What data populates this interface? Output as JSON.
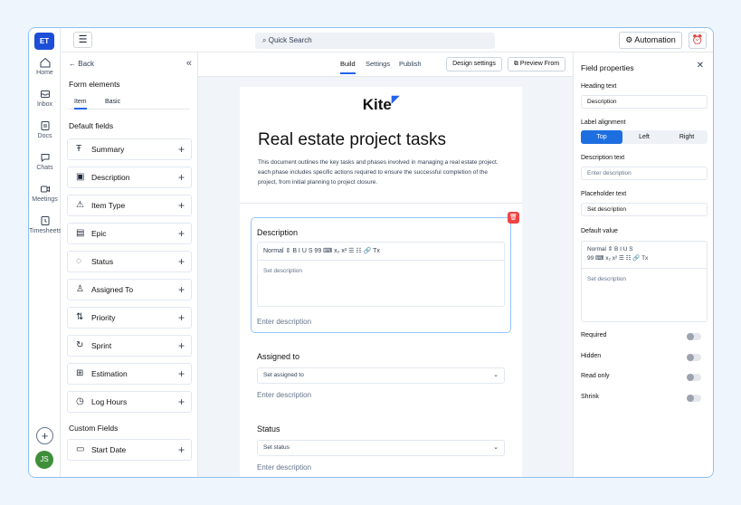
{
  "rail": {
    "workspace_initials": "ET",
    "items": [
      {
        "label": "Home",
        "icon": "home-icon"
      },
      {
        "label": "Inbox",
        "icon": "inbox-icon"
      },
      {
        "label": "Docs",
        "icon": "docs-icon"
      },
      {
        "label": "Chats",
        "icon": "chats-icon"
      },
      {
        "label": "Meetings",
        "icon": "meetings-icon"
      },
      {
        "label": "Timesheets",
        "icon": "timesheets-icon"
      }
    ],
    "add_label": "+",
    "avatar_initials": "JS"
  },
  "topbar": {
    "search_placeholder": "Quick Search",
    "automation_label": "Automation"
  },
  "left_panel": {
    "back_label": "Back",
    "collapse_label": "«",
    "title": "Form elements",
    "tabs": [
      "Item",
      "Basic"
    ],
    "default_fields_heading": "Default fields",
    "default_fields": [
      {
        "label": "Summary",
        "icon": "text-icon"
      },
      {
        "label": "Description",
        "icon": "description-icon"
      },
      {
        "label": "Item Type",
        "icon": "warning-icon"
      },
      {
        "label": "Epic",
        "icon": "epic-icon"
      },
      {
        "label": "Status",
        "icon": "status-icon"
      },
      {
        "label": "Assigned To",
        "icon": "user-icon"
      },
      {
        "label": "Priority",
        "icon": "priority-icon"
      },
      {
        "label": "Sprint",
        "icon": "sprint-icon"
      },
      {
        "label": "Estimation",
        "icon": "estimation-icon"
      },
      {
        "label": "Log Hours",
        "icon": "clock-icon"
      }
    ],
    "custom_fields_heading": "Custom Fields",
    "custom_fields": [
      {
        "label": "Start Date",
        "icon": "calendar-icon"
      }
    ]
  },
  "center": {
    "tabs": [
      "Build",
      "Settings",
      "Publish"
    ],
    "active_tab": "Build",
    "design_settings_label": "Design settings",
    "preview_form_label": "Preview From",
    "logo_text": "Kite",
    "doc_title": "Real estate project tasks",
    "doc_description": "This document outlines the key tasks and phases involved in managing a real estate project. each phase includes specific actions required to ensure the successful completion of the project, from initial planning to project closure.",
    "blocks": [
      {
        "label": "Description",
        "editor_toolbar": "Normal  ⇕   B   I   U   S   99   ⌨   x₂  x²   ☰   ☷   🔗   Tx",
        "editor_placeholder": "Set description",
        "hint": "Enter description"
      },
      {
        "label": "Assigned to",
        "select_placeholder": "Set assigned to",
        "hint": "Enter description"
      },
      {
        "label": "Status",
        "select_placeholder": "Set status",
        "hint": "Enter description"
      }
    ]
  },
  "right_panel": {
    "title": "Field properties",
    "heading_text_label": "Heading text",
    "heading_text_value": "Description",
    "label_alignment_label": "Label alignment",
    "alignment_options": [
      "Top",
      "Left",
      "Right"
    ],
    "alignment_selected": "Top",
    "description_text_label": "Description text",
    "description_text_placeholder": "Enter description",
    "placeholder_text_label": "Placeholder text",
    "placeholder_text_value": "Set description",
    "default_value_label": "Default value",
    "default_value_toolbar_1": "Normal  ⇕   B   I   U   S",
    "default_value_toolbar_2": "99  ⌨  x₂  x²  ☰  ☷  🔗  Tx",
    "default_value_placeholder": "Set description",
    "toggles": [
      {
        "label": "Required",
        "on": false
      },
      {
        "label": "Hidden",
        "on": false
      },
      {
        "label": "Read only",
        "on": false
      },
      {
        "label": "Shrink",
        "on": false
      }
    ]
  }
}
